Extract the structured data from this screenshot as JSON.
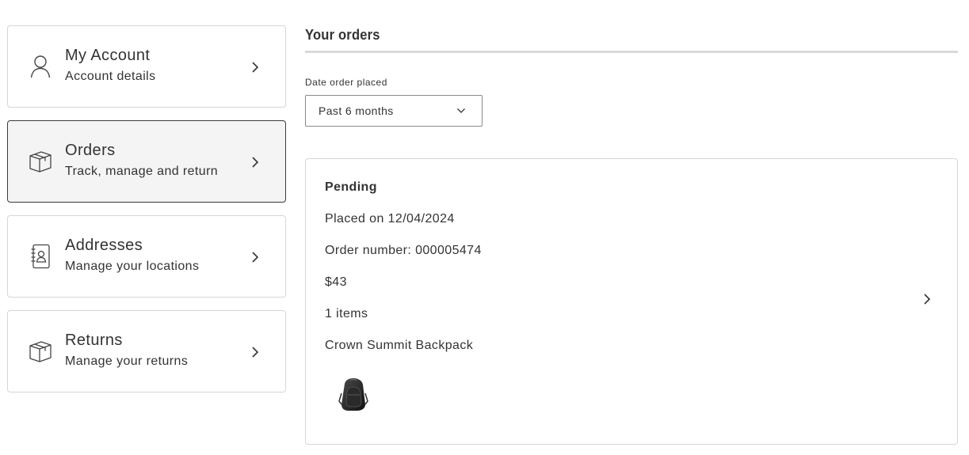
{
  "sidebar": {
    "items": [
      {
        "title": "My Account",
        "subtitle": "Account details",
        "icon": "user-icon",
        "active": false
      },
      {
        "title": "Orders",
        "subtitle": "Track, manage and return",
        "icon": "box-icon",
        "active": true
      },
      {
        "title": "Addresses",
        "subtitle": "Manage your locations",
        "icon": "address-book-icon",
        "active": false
      },
      {
        "title": "Returns",
        "subtitle": "Manage your returns",
        "icon": "box-icon",
        "active": false
      }
    ]
  },
  "main": {
    "title": "Your orders",
    "filter": {
      "label": "Date order placed",
      "selected": "Past 6 months"
    },
    "orders": [
      {
        "status": "Pending",
        "placed": "Placed on 12/04/2024",
        "number": "Order number: 000005474",
        "total": "$43",
        "items_count": "1 items",
        "product_name": "Crown Summit Backpack",
        "thumbnail": "backpack-image"
      }
    ]
  },
  "colors": {
    "border": "#d6d6d6",
    "active_border": "#3a3a3a",
    "active_bg": "#f4f4f4",
    "text": "#333333"
  }
}
